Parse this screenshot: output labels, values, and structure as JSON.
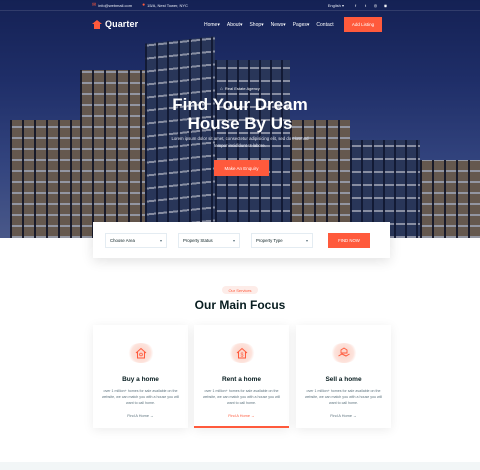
{
  "colors": {
    "accent": "#ff5a3c",
    "heading": "#071c1f",
    "muted": "#5c727d"
  },
  "topbar": {
    "email": "info@webmail.com",
    "address": "15/A, Nest Tower, NYC",
    "language": "English",
    "social_icons": [
      "facebook-icon",
      "twitter-icon",
      "instagram-icon",
      "dribbble-icon"
    ]
  },
  "nav": {
    "logo": "Quarter",
    "menu": [
      "Home",
      "About",
      "Shop",
      "News",
      "Pages",
      "Contact"
    ],
    "add_listing": "Add Listing"
  },
  "hero": {
    "eyebrow": "Real Estate Agency",
    "headline_line1": "Find Your Dream",
    "headline_line2": "House By Us",
    "subtext": "Lorem ipsum dolor sit amet, consectetur adipisicing elit, sed do eiusmod tempor incididunt ut labore.",
    "cta": "Make An Enquiry"
  },
  "search": {
    "area": "Choose Area",
    "status": "Property Status",
    "type": "Property Type",
    "button": "FIND NOW"
  },
  "services": {
    "tag": "Our Services",
    "title": "Our Main Focus",
    "cards": [
      {
        "icon": "buy-home-icon",
        "title": "Buy a home",
        "desc": "over 1 million+ homes for sale available on the website, we can match you with a house you will want to call home.",
        "link": "Find A Home →"
      },
      {
        "icon": "rent-home-icon",
        "title": "Rent a home",
        "desc": "over 1 million+ homes for sale available on the website, we can match you with a house you will want to call home.",
        "link": "Find A Home →"
      },
      {
        "icon": "sell-home-icon",
        "title": "Sell a home",
        "desc": "over 1 million+ homes for sale available on the website, we can match you with a house you will want to call home.",
        "link": "Find A Home →"
      }
    ]
  }
}
